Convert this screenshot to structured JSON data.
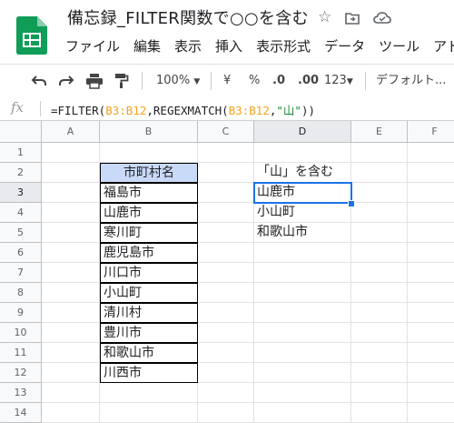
{
  "doc": {
    "title": "備忘録_FILTER関数で○○を含む"
  },
  "menu": [
    "ファイル",
    "編集",
    "表示",
    "挿入",
    "表示形式",
    "データ",
    "ツール",
    "アド"
  ],
  "toolbar": {
    "zoom": "100%",
    "currency": "¥",
    "percent": "%",
    "dec_less": ".0",
    "dec_more": ".00",
    "format": "123",
    "font": "デフォルト..."
  },
  "formula": {
    "prefix": "=FILTER(",
    "range1": "B3:B12",
    "mid": ",REGEXMATCH(",
    "range2": "B3:B12",
    "comma": ",",
    "str": "\"山\"",
    "suffix": "))"
  },
  "columns": [
    "A",
    "B",
    "C",
    "D",
    "E",
    "F"
  ],
  "rows": [
    "1",
    "2",
    "3",
    "4",
    "5",
    "6",
    "7",
    "8",
    "9",
    "10",
    "11",
    "12",
    "13",
    "14"
  ],
  "table": {
    "header": "市町村名",
    "items": [
      "福島市",
      "山鹿市",
      "寒川町",
      "鹿児島市",
      "川口市",
      "小山町",
      "清川村",
      "豊川市",
      "和歌山市",
      "川西市"
    ]
  },
  "result": {
    "label": "「山」を含む",
    "items": [
      "山鹿市",
      "小山町",
      "和歌山市"
    ]
  },
  "selected_cell": "D3"
}
